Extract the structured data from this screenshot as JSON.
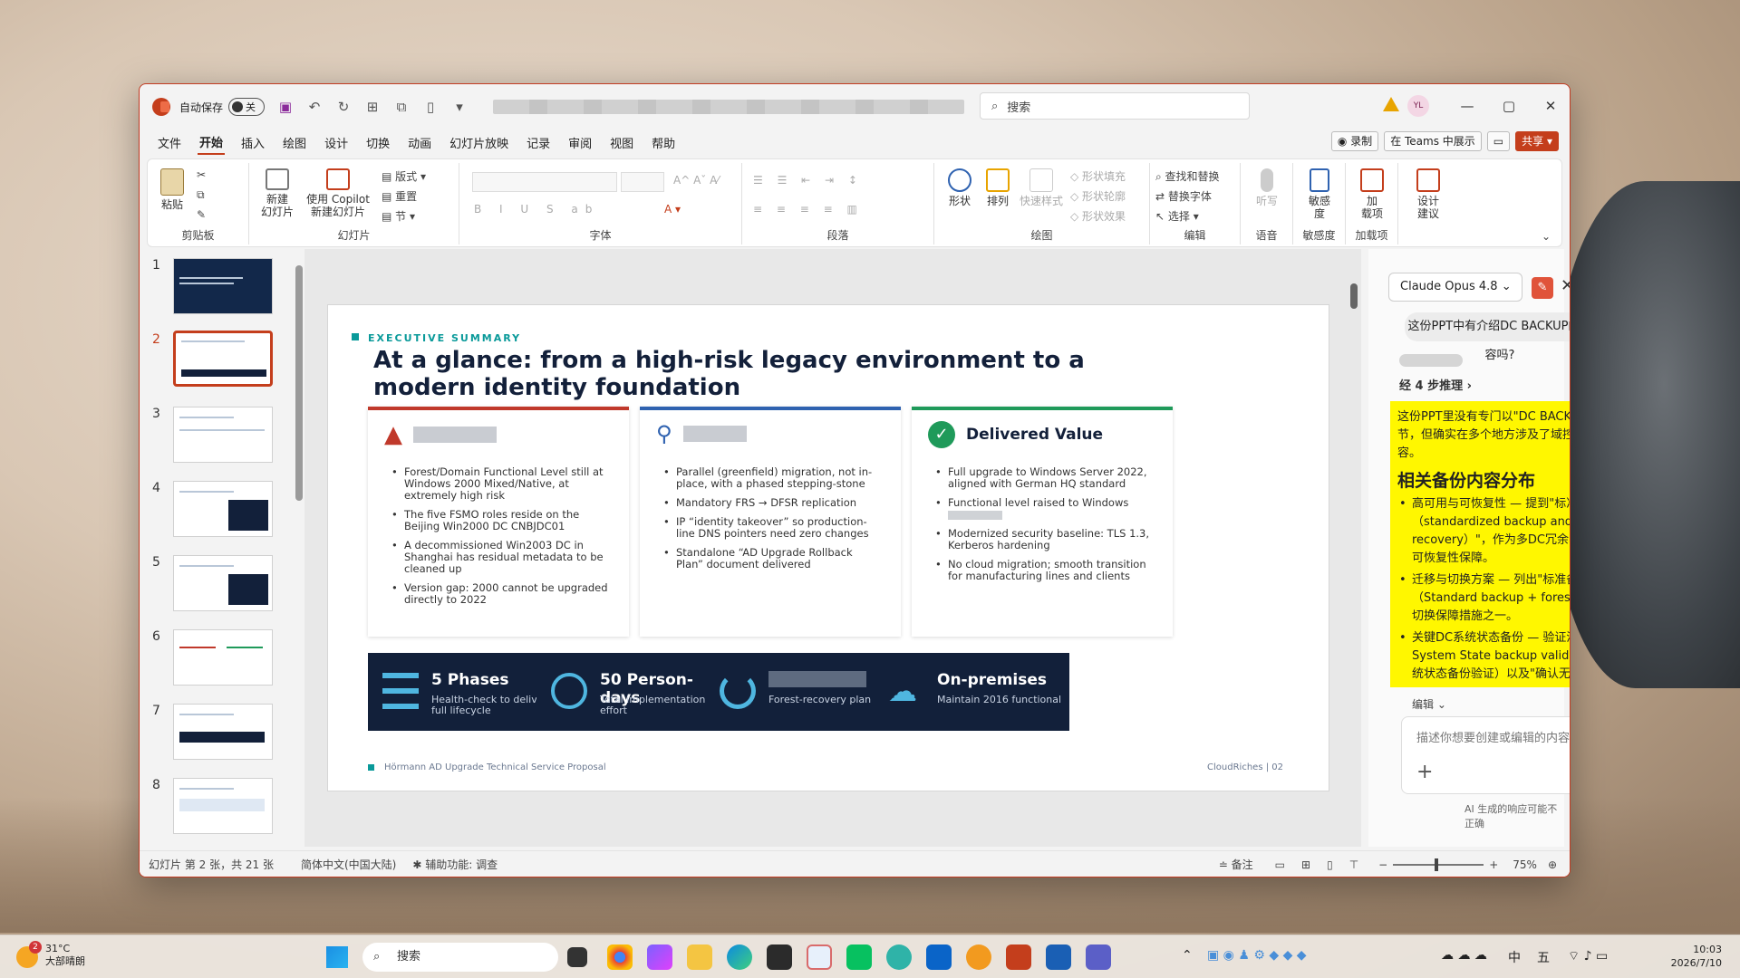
{
  "titlebar": {
    "autosave_label": "自动保存",
    "autosave_state": "关",
    "search_placeholder": "搜索",
    "avatar_initials": "YL"
  },
  "menu": {
    "items": [
      "文件",
      "开始",
      "插入",
      "绘图",
      "设计",
      "切换",
      "动画",
      "幻灯片放映",
      "记录",
      "审阅",
      "视图",
      "帮助"
    ],
    "active_index": 1,
    "record": "录制",
    "present_teams": "在 Teams 中展示",
    "share": "共享"
  },
  "ribbon": {
    "paste": "粘贴",
    "clipboard": "剪贴板",
    "new_slide": "新建\n幻灯片",
    "copilot_slide": "使用 Copilot\n新建幻灯片",
    "layout": "版式",
    "reset": "重置",
    "section": "节",
    "slides_group": "幻灯片",
    "font_group": "字体",
    "paragraph_group": "段落",
    "shapes": "形状",
    "arrange": "排列",
    "quick_styles": "快速样式",
    "shape_fill": "形状填充",
    "shape_outline": "形状轮廓",
    "shape_effects": "形状效果",
    "drawing_group": "绘图",
    "find_replace": "查找和替换",
    "replace_font": "替换字体",
    "select": "选择",
    "editing_group": "编辑",
    "dictate": "听写",
    "voice_group": "语音",
    "sensitivity": "敏感\n度",
    "sensitivity_group": "敏感度",
    "addins": "加\n载项",
    "addins_group": "加载项",
    "designer": "设计\n建议"
  },
  "thumbnails": [
    "1",
    "2",
    "3",
    "4",
    "5",
    "6",
    "7",
    "8"
  ],
  "selected_slide": 2,
  "slide": {
    "eyebrow": "EXECUTIVE SUMMARY",
    "title": "At a glance: from a high-risk legacy environment to a modern identity foundation",
    "cards": [
      {
        "accent": "#c0392b",
        "heading": "",
        "bullets": [
          "Forest/Domain Functional Level still at Windows 2000 Mixed/Native, at extremely high risk",
          "The five FSMO roles reside on the Beijing Win2000 DC CNBJDC01",
          "A decommissioned Win2003 DC in Shanghai has residual metadata to be cleaned up",
          "Version gap: 2000 cannot be upgraded directly to 2022"
        ]
      },
      {
        "accent": "#2f62b0",
        "heading": "",
        "bullets": [
          "Parallel (greenfield) migration, not in-place, with a phased stepping-stone",
          "Mandatory FRS → DFSR replication",
          "IP “identity takeover” so production-line DNS pointers need zero changes",
          "Standalone “AD Upgrade Rollback Plan” document delivered"
        ]
      },
      {
        "accent": "#1f9a5a",
        "heading": "Delivered Value",
        "bullets": [
          "Full upgrade to Windows Server 2022, aligned with German HQ standard",
          "Functional level raised to Windows",
          "Modernized security baseline: TLS 1.3, Kerberos hardening",
          "No cloud migration; smooth transition for manufacturing lines and clients"
        ]
      }
    ],
    "stats": [
      {
        "big": "5 Phases",
        "small": "Health-check to delivery, full lifecycle"
      },
      {
        "big": "50 Person-days",
        "small": "Total implementation effort"
      },
      {
        "big": "",
        "small": "Forest-recovery plan"
      },
      {
        "big": "On-premises",
        "small": "Maintain 2016 functional"
      }
    ],
    "footer_left": "Hörmann AD Upgrade Technical Service Proposal",
    "footer_right": "CloudRiches  |  02"
  },
  "copilot": {
    "model": "Claude Opus 4.8",
    "user_question": "这份PPT中有介绍DC BACKUP的内容吗?",
    "steps": "经 4 步推理",
    "answer_intro": "这份PPT里没有专门以\"DC BACKUP\"为标题的独立章节，但确实在多个地方涉及了域控（DC）备份的内容。",
    "answer_heading": "相关备份内容分布",
    "answer_items": [
      "高可用与可恢复性 — 提到\"标准化备份与林恢复（standardized backup and forest-recovery）\"，作为多DC冗余、DFSR复制之外的可恢复性保障。",
      "迁移与切换方案 — 列出\"标准备份 + 林恢复（Standard backup + forest recovery）\"作为切换保障措施之一。",
      "关键DC系统状态备份 — 验证清单中包含\"Key DC System State backup validation\"（关键DC系统状态备份验证）以及\"确认无残留元数"
    ],
    "edit_label": "编辑",
    "input_placeholder": "描述你想要创建或编辑的内容",
    "disclaimer": "AI 生成的响应可能不正确"
  },
  "status": {
    "slide_info": "幻灯片 第 2 张，共 21 张",
    "language": "简体中文(中国大陆)",
    "accessibility": "辅助功能: 调查",
    "notes": "备注",
    "zoom": "75%"
  },
  "taskbar": {
    "weather_temp": "31°C",
    "weather_desc": "大部晴朗",
    "weather_badge": "2",
    "search": "搜索",
    "ime1": "中",
    "ime2": "五",
    "time": "10:03",
    "date": "2026/7/10"
  }
}
